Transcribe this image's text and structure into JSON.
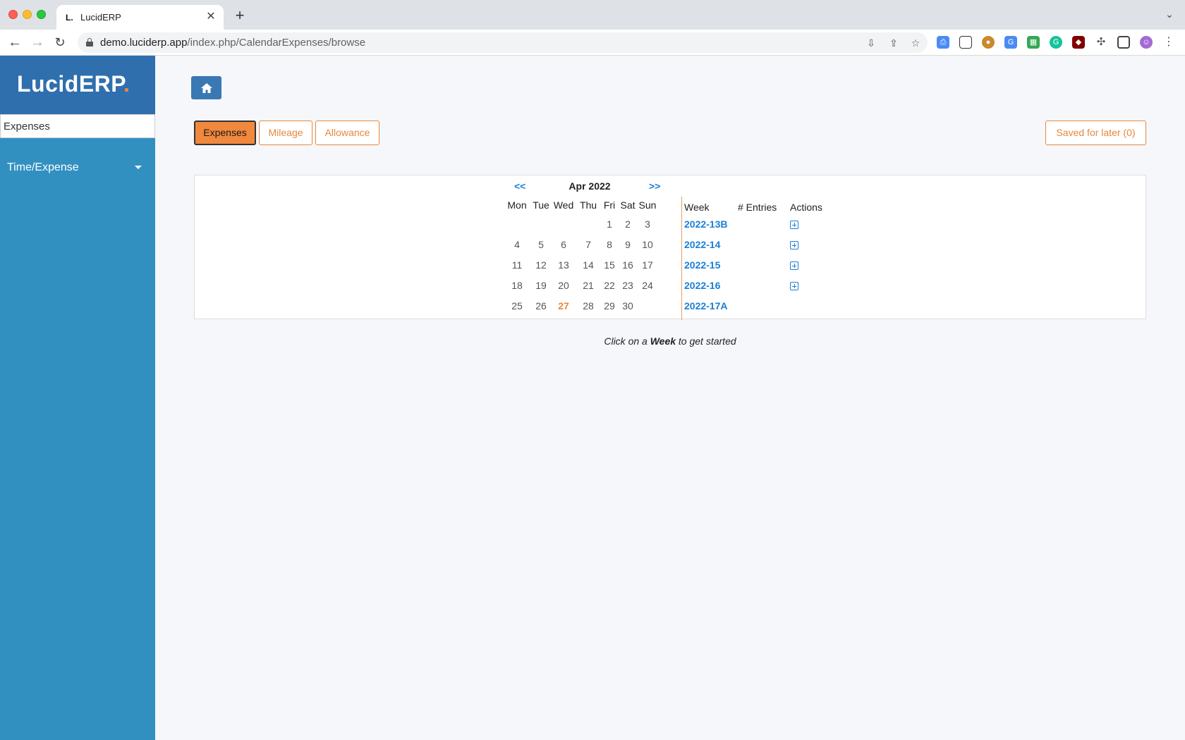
{
  "browser": {
    "tab_title": "LucidERP",
    "tab_favicon": "L.",
    "url_host": "demo.luciderp.app",
    "url_path": "/index.php/CalendarExpenses/browse"
  },
  "sidebar": {
    "logo_text": "LucidERP",
    "logo_dot": ".",
    "search_value": "Expenses",
    "menu_label": "Time/Expense"
  },
  "tabs": [
    {
      "label": "Expenses",
      "active": true
    },
    {
      "label": "Mileage",
      "active": false
    },
    {
      "label": "Allowance",
      "active": false
    }
  ],
  "saved_label": "Saved for later (0)",
  "calendar": {
    "prev": "<<",
    "next": ">>",
    "title": "Apr 2022",
    "day_headers": [
      "Mon",
      "Tue",
      "Wed",
      "Thu",
      "Fri",
      "Sat",
      "Sun"
    ],
    "weeks": [
      [
        "",
        "",
        "",
        "",
        "1",
        "2",
        "3"
      ],
      [
        "4",
        "5",
        "6",
        "7",
        "8",
        "9",
        "10"
      ],
      [
        "11",
        "12",
        "13",
        "14",
        "15",
        "16",
        "17"
      ],
      [
        "18",
        "19",
        "20",
        "21",
        "22",
        "23",
        "24"
      ],
      [
        "25",
        "26",
        "27",
        "28",
        "29",
        "30",
        ""
      ]
    ],
    "today": "27"
  },
  "week_table": {
    "headers": {
      "week": "Week",
      "entries": "# Entries",
      "actions": "Actions"
    },
    "rows": [
      {
        "week": "2022-13B",
        "has_action": true
      },
      {
        "week": "2022-14",
        "has_action": true
      },
      {
        "week": "2022-15",
        "has_action": true
      },
      {
        "week": "2022-16",
        "has_action": true
      },
      {
        "week": "2022-17A",
        "has_action": false
      }
    ]
  },
  "hint": {
    "before": "Click on a ",
    "bold": "Week",
    "after": " to get started"
  }
}
